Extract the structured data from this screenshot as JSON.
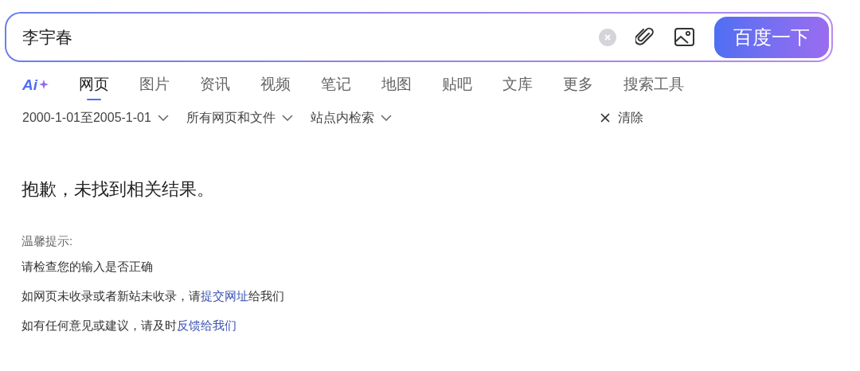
{
  "search": {
    "value": "李宇春",
    "button": "百度一下"
  },
  "ai_logo": "Ai",
  "tabs": [
    {
      "label": "网页",
      "selected": true
    },
    {
      "label": "图片",
      "selected": false
    },
    {
      "label": "资讯",
      "selected": false
    },
    {
      "label": "视频",
      "selected": false
    },
    {
      "label": "笔记",
      "selected": false
    },
    {
      "label": "地图",
      "selected": false
    },
    {
      "label": "贴吧",
      "selected": false
    },
    {
      "label": "文库",
      "selected": false
    },
    {
      "label": "更多",
      "selected": false
    },
    {
      "label": "搜索工具",
      "selected": false
    }
  ],
  "filters": [
    "2000-1-01至2005-1-01",
    "所有网页和文件",
    "站点内检索"
  ],
  "clear_filters": "清除",
  "message": "抱歉，未找到相关结果。",
  "tips_title": "温馨提示:",
  "tips": [
    {
      "before": "请检查您的输入是否正确"
    },
    {
      "before": "如网页未收录或者新站未收录，请",
      "link": "提交网址",
      "after": "给我们"
    },
    {
      "before": "如有任何意见或建议，请及时",
      "link": "反馈给我们"
    }
  ]
}
